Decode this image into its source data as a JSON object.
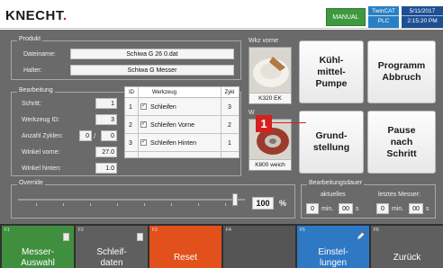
{
  "header": {
    "logo": "KNECHT",
    "mode_button": "MANUAL",
    "twincat_label": "TwinCAT",
    "twincat_status": "PLC",
    "date": "5/11/2017",
    "time": "2:15:20 PM"
  },
  "produkt": {
    "title": "Produkt",
    "dateiname_label": "Dateiname:",
    "dateiname_value": "Schiwa G 26 0.dat",
    "halter_label": "Halter:",
    "halter_value": "Schiwa G Messer"
  },
  "bearbeitung": {
    "title": "Bearbeitung",
    "schritt_label": "Schritt:",
    "schritt_value": "1",
    "werkzeug_id_label": "Werkzeug ID:",
    "werkzeug_id_value": "3",
    "anzahl_zyklen_label": "Anzahl Zyklen:",
    "anzahl_zyklen_value": "0",
    "anzahl_zyklen_sep": "/",
    "anzahl_zyklen_total": "0",
    "winkel_vorne_label": "Winkel vorne:",
    "winkel_vorne_value": "27.0",
    "winkel_hinten_label": "Winkel hinten:",
    "winkel_hinten_value": "1.0"
  },
  "table": {
    "headers": {
      "id": "ID",
      "werkzeug": "Werkzeug",
      "zyk": "Zykl"
    },
    "rows": [
      {
        "id": "1",
        "checked": true,
        "werkzeug": "Schleifen",
        "zyk": "3"
      },
      {
        "id": "2",
        "checked": true,
        "werkzeug": "Schleifen Vorne",
        "zyk": "2"
      },
      {
        "id": "3",
        "checked": true,
        "werkzeug": "Schleifen Hinten",
        "zyk": "1"
      }
    ],
    "check_glyph": "✓"
  },
  "wkz": {
    "title": "Wkz vorne",
    "title2": "W",
    "img1_caption": "K320 EK",
    "img2_caption": "K800 weich"
  },
  "marker": {
    "label": "1"
  },
  "buttons": {
    "kuehlmittel": "Kühl-\nmittel-\nPumpe",
    "programm_abbruch": "Programm\nAbbruch",
    "grundstellung": "Grund-\nstellung",
    "pause": "Pause\nnach\nSchritt"
  },
  "override": {
    "title": "Override",
    "value": "100",
    "unit": "%",
    "level_percent": 100
  },
  "dauer": {
    "title": "Bearbeitungsdauer",
    "aktuelles_label": "aktuelles",
    "letztes_label": "letztes Messer:",
    "akt_min": "0",
    "akt_sec": "00",
    "letzt_min": "0",
    "letzt_sec": "00",
    "min_unit": "min.",
    "sec_unit": "s"
  },
  "footer": {
    "keys": [
      {
        "num": "F1",
        "label": "Messer-\nAuswahl",
        "color": "#3f8f3f"
      },
      {
        "num": "F2",
        "label": "Schleif-\ndaten",
        "color": "#5f5f5f"
      },
      {
        "num": "F3",
        "label": "Reset",
        "color": "#e2501b"
      },
      {
        "num": "F4",
        "label": "",
        "color": "#555555"
      },
      {
        "num": "F5",
        "label": "Einstel-\nlungen",
        "color": "#2f79c4"
      },
      {
        "num": "F6",
        "label": "Zurück",
        "color": "#5f5f5f"
      }
    ]
  },
  "colors": {
    "accent_green": "#3f9a3f",
    "accent_blue": "#2a7fc3",
    "marker_red": "#d42020",
    "reset_orange": "#e2501b"
  }
}
